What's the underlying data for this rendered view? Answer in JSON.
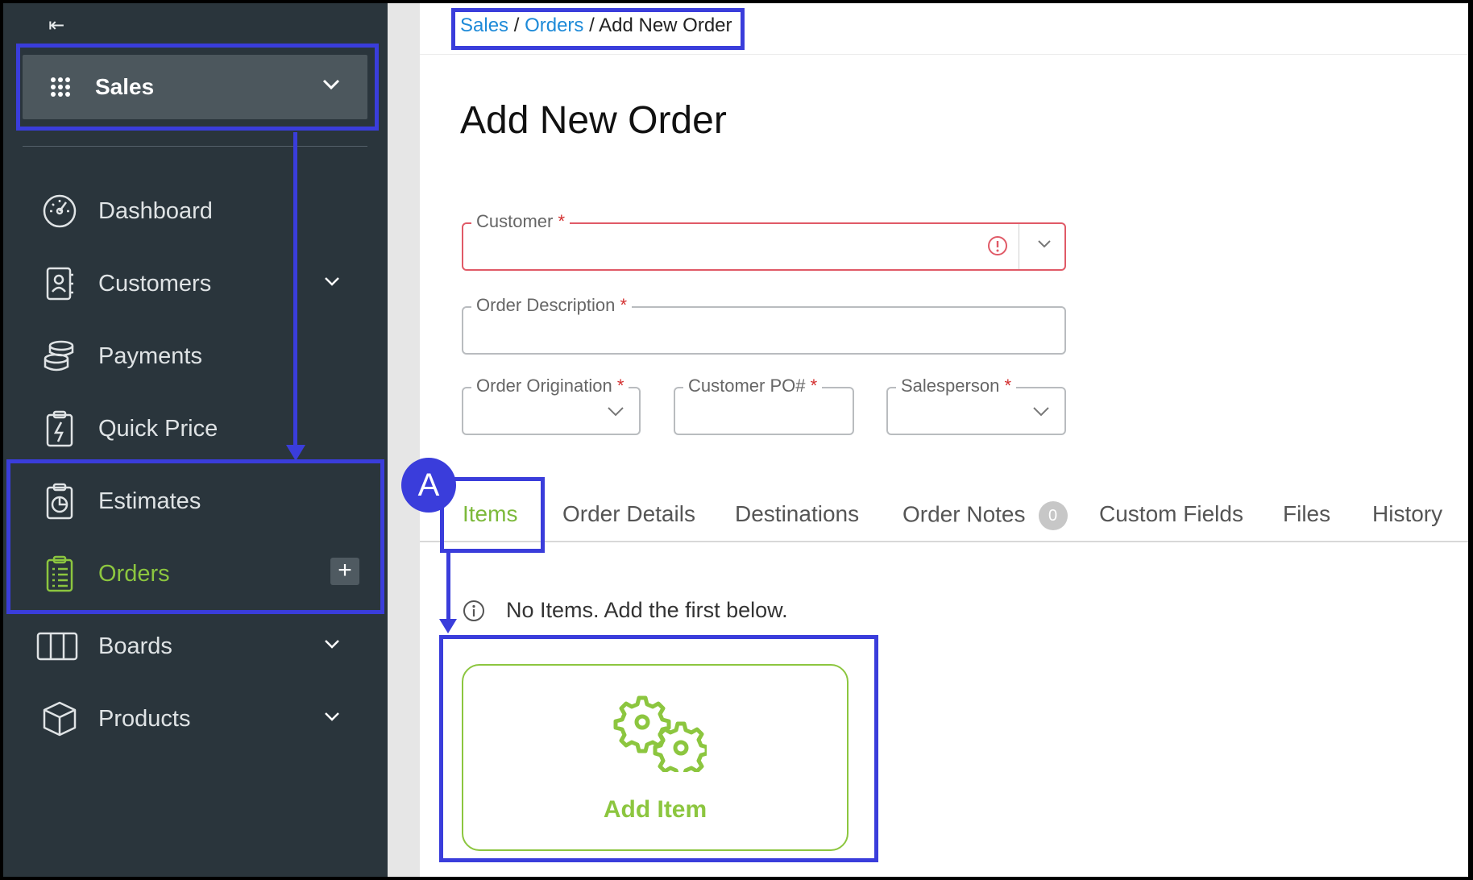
{
  "sidebar": {
    "collapse_glyph": "⇤",
    "switcher": {
      "label": "Sales",
      "icon": "grid-icon"
    },
    "items": [
      {
        "label": "Dashboard",
        "icon": "dashboard-gauge-icon",
        "expandable": false
      },
      {
        "label": "Customers",
        "icon": "contacts-icon",
        "expandable": true
      },
      {
        "label": "Payments",
        "icon": "payments-coins-icon",
        "expandable": false
      },
      {
        "label": "Quick Price",
        "icon": "quick-price-icon",
        "expandable": false
      },
      {
        "label": "Estimates",
        "icon": "estimates-clipboard-icon",
        "expandable": false
      },
      {
        "label": "Orders",
        "icon": "orders-clipboard-icon",
        "expandable": false,
        "active": true
      },
      {
        "label": "Boards",
        "icon": "boards-icon",
        "expandable": true
      },
      {
        "label": "Products",
        "icon": "products-box-icon",
        "expandable": true
      }
    ],
    "orders_add_glyph": "+"
  },
  "breadcrumb": {
    "sales": "Sales",
    "sep1": " / ",
    "orders": "Orders",
    "sep2": " / ",
    "current": "Add New Order"
  },
  "page_title": "Add New Order",
  "form": {
    "customer": {
      "label": "Customer",
      "required": "*",
      "value": "",
      "state": "error"
    },
    "order_description": {
      "label": "Order Description",
      "required": "*",
      "value": ""
    },
    "order_origination": {
      "label": "Order Origination",
      "required": "*",
      "value": ""
    },
    "customer_po": {
      "label": "Customer PO#",
      "required": "*",
      "value": ""
    },
    "salesperson": {
      "label": "Salesperson",
      "required": "*",
      "value": ""
    }
  },
  "tabs": [
    {
      "label": "Items",
      "active": true
    },
    {
      "label": "Order Details"
    },
    {
      "label": "Destinations"
    },
    {
      "label": "Order Notes",
      "count": "0"
    },
    {
      "label": "Custom Fields"
    },
    {
      "label": "Files"
    },
    {
      "label": "History"
    }
  ],
  "items_panel": {
    "empty_message": "No Items. Add the first below.",
    "add_item_label": "Add Item",
    "add_item_icon": "gears-icon"
  },
  "annotations": {
    "badge": "A"
  },
  "colors": {
    "sidebar_bg": "#2a353c",
    "accent_green": "#8cc63f",
    "link_blue": "#1d8ad8",
    "error_red": "#e05a67",
    "annotation_blue": "#3a3ddb"
  }
}
